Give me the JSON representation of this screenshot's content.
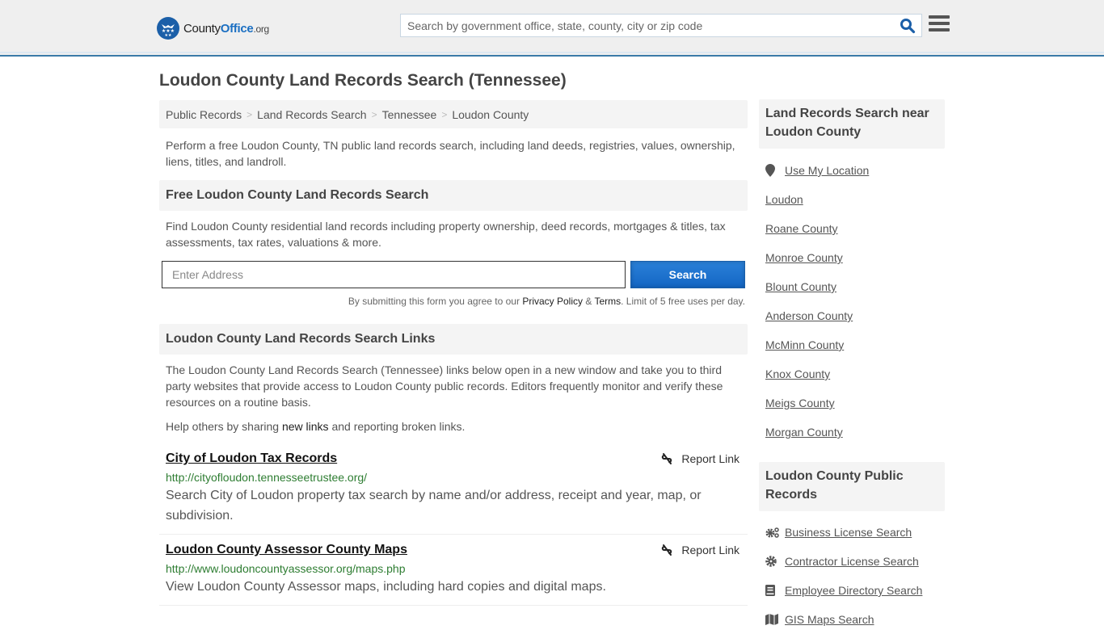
{
  "header": {
    "logo": {
      "name_part1": "County",
      "name_part2": "Office",
      "tld": ".org"
    },
    "search": {
      "placeholder": "Search by government office, state, county, city or zip code",
      "value": ""
    },
    "colors": {
      "brand_blue": "#1b6fc2",
      "topbar_border": "#3a7aa8"
    }
  },
  "page": {
    "title": "Loudon County Land Records Search (Tennessee)"
  },
  "breadcrumb": [
    {
      "label": "Public Records"
    },
    {
      "label": "Land Records Search"
    },
    {
      "label": "Tennessee"
    },
    {
      "label": "Loudon County"
    }
  ],
  "intro": "Perform a free Loudon County, TN public land records search, including land deeds, registries, values, ownership, liens, titles, and landroll.",
  "free_search": {
    "heading": "Free Loudon County Land Records Search",
    "description": "Find Loudon County residential land records including property ownership, deed records, mortgages & titles, tax assessments, tax rates, valuations & more.",
    "address_placeholder": "Enter Address",
    "address_value": "",
    "button_label": "Search",
    "disclaimer": {
      "before": "By submitting this form you agree to our ",
      "privacy": "Privacy Policy",
      "amp": " & ",
      "terms": "Terms",
      "after": ". Limit of 5 free uses per day."
    }
  },
  "links_section": {
    "heading": "Loudon County Land Records Search Links",
    "description": "The Loudon County Land Records Search (Tennessee) links below open in a new window and take you to third party websites that provide access to Loudon County public records. Editors frequently monitor and verify these resources on a routine basis.",
    "help_before": "Help others by sharing ",
    "help_link": "new links",
    "help_after": " and reporting broken links.",
    "report_label": "Report Link",
    "items": [
      {
        "title": "City of Loudon Tax Records",
        "url": "http://cityofloudon.tennesseetrustee.org/",
        "description": "Search City of Loudon property tax search by name and/or address, receipt and year, map, or subdivision."
      },
      {
        "title": "Loudon County Assessor County Maps",
        "url": "http://www.loudoncountyassessor.org/maps.php",
        "description": "View Loudon County Assessor maps, including hard copies and digital maps."
      }
    ]
  },
  "sidebar": {
    "nearby": {
      "heading": "Land Records Search near Loudon County",
      "use_location": "Use My Location",
      "items": [
        "Loudon",
        "Roane County",
        "Monroe County",
        "Blount County",
        "Anderson County",
        "McMinn County",
        "Knox County",
        "Meigs County",
        "Morgan County"
      ]
    },
    "public_records": {
      "heading": "Loudon County Public Records",
      "items": [
        {
          "label": "Business License Search",
          "icon": "gears-icon"
        },
        {
          "label": "Contractor License Search",
          "icon": "gear-icon"
        },
        {
          "label": "Employee Directory Search",
          "icon": "book-icon"
        },
        {
          "label": "GIS Maps Search",
          "icon": "map-icon"
        }
      ]
    }
  }
}
